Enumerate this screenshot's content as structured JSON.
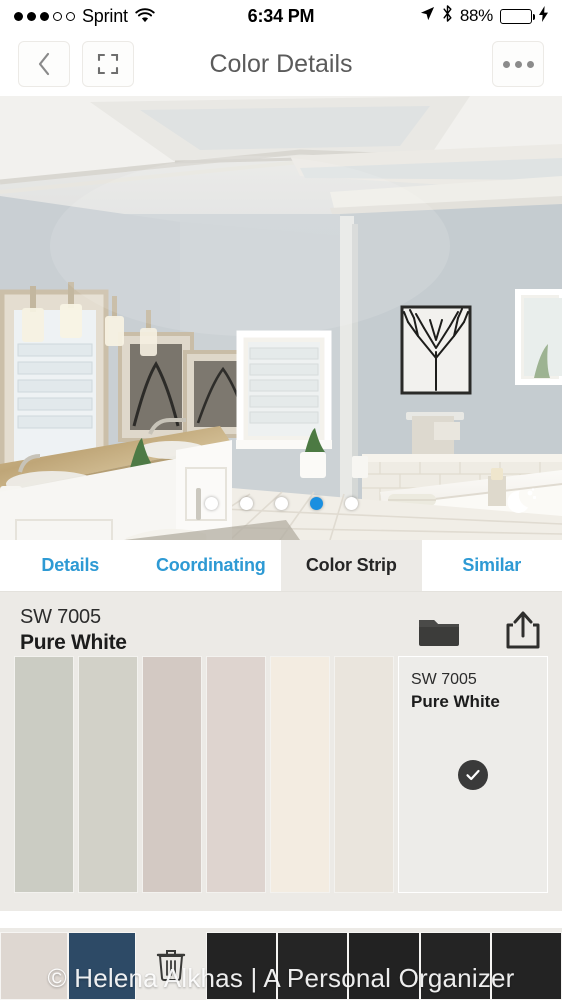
{
  "statusbar": {
    "signal_filled": 3,
    "signal_empty": 2,
    "carrier": "Sprint",
    "wifi_icon": "wifi-icon",
    "time": "6:34 PM",
    "location_icon": "location-arrow-icon",
    "bluetooth_icon": "bluetooth-icon",
    "battery_percent": "88%",
    "battery_level": 88,
    "charging_icon": "lightning-bolt-icon",
    "battery_color": "#4cd964"
  },
  "navbar": {
    "back_icon": "chevron-left-icon",
    "expand_icon": "fullscreen-expand-icon",
    "title": "Color Details",
    "more_icon": "more-horizontal-icon"
  },
  "hero": {
    "alt": "bathroom-interior-photo",
    "carousel": {
      "count": 5,
      "active_index": 3
    },
    "night_mode_icon": "moon-stars-icon"
  },
  "tabs": [
    {
      "label": "Details",
      "active": false,
      "name": "tab-details"
    },
    {
      "label": "Coordinating",
      "active": false,
      "name": "tab-coordinating"
    },
    {
      "label": "Color Strip",
      "active": true,
      "name": "tab-color-strip"
    },
    {
      "label": "Similar",
      "active": false,
      "name": "tab-similar"
    }
  ],
  "color_header": {
    "code": "SW 7005",
    "name": "Pure White",
    "folder_icon": "folder-icon",
    "share_icon": "share-upload-icon"
  },
  "color_strip": {
    "swatches": [
      {
        "hex": "#cbccc3",
        "selected": false
      },
      {
        "hex": "#d2d1c8",
        "selected": false
      },
      {
        "hex": "#d3c9c3",
        "selected": false
      },
      {
        "hex": "#ded4cf",
        "selected": false
      },
      {
        "hex": "#f3ece1",
        "selected": false
      },
      {
        "hex": "#eae5dd",
        "selected": false
      }
    ],
    "selected_swatch": {
      "hex": "#edece9",
      "code": "SW 7005",
      "name": "Pure White",
      "check_icon": "check-circle-icon",
      "selected": true
    }
  },
  "bottom_row": {
    "swatches": [
      {
        "hex": "#ded7d1",
        "kind": "light"
      },
      {
        "hex": "#2d4a66",
        "kind": "navy"
      }
    ],
    "trash_icon": "trash-icon",
    "dark_swatches": [
      {
        "hex": "#232323"
      },
      {
        "hex": "#252525"
      },
      {
        "hex": "#222222"
      },
      {
        "hex": "#242424"
      },
      {
        "hex": "#232323"
      }
    ]
  },
  "watermark": {
    "text": "© Helena Alkhas | A Personal Organizer"
  },
  "theme": {
    "accent_blue": "#2e9ad4",
    "panel_gray": "#eceae6",
    "active_dot": "#1a8fe0"
  }
}
